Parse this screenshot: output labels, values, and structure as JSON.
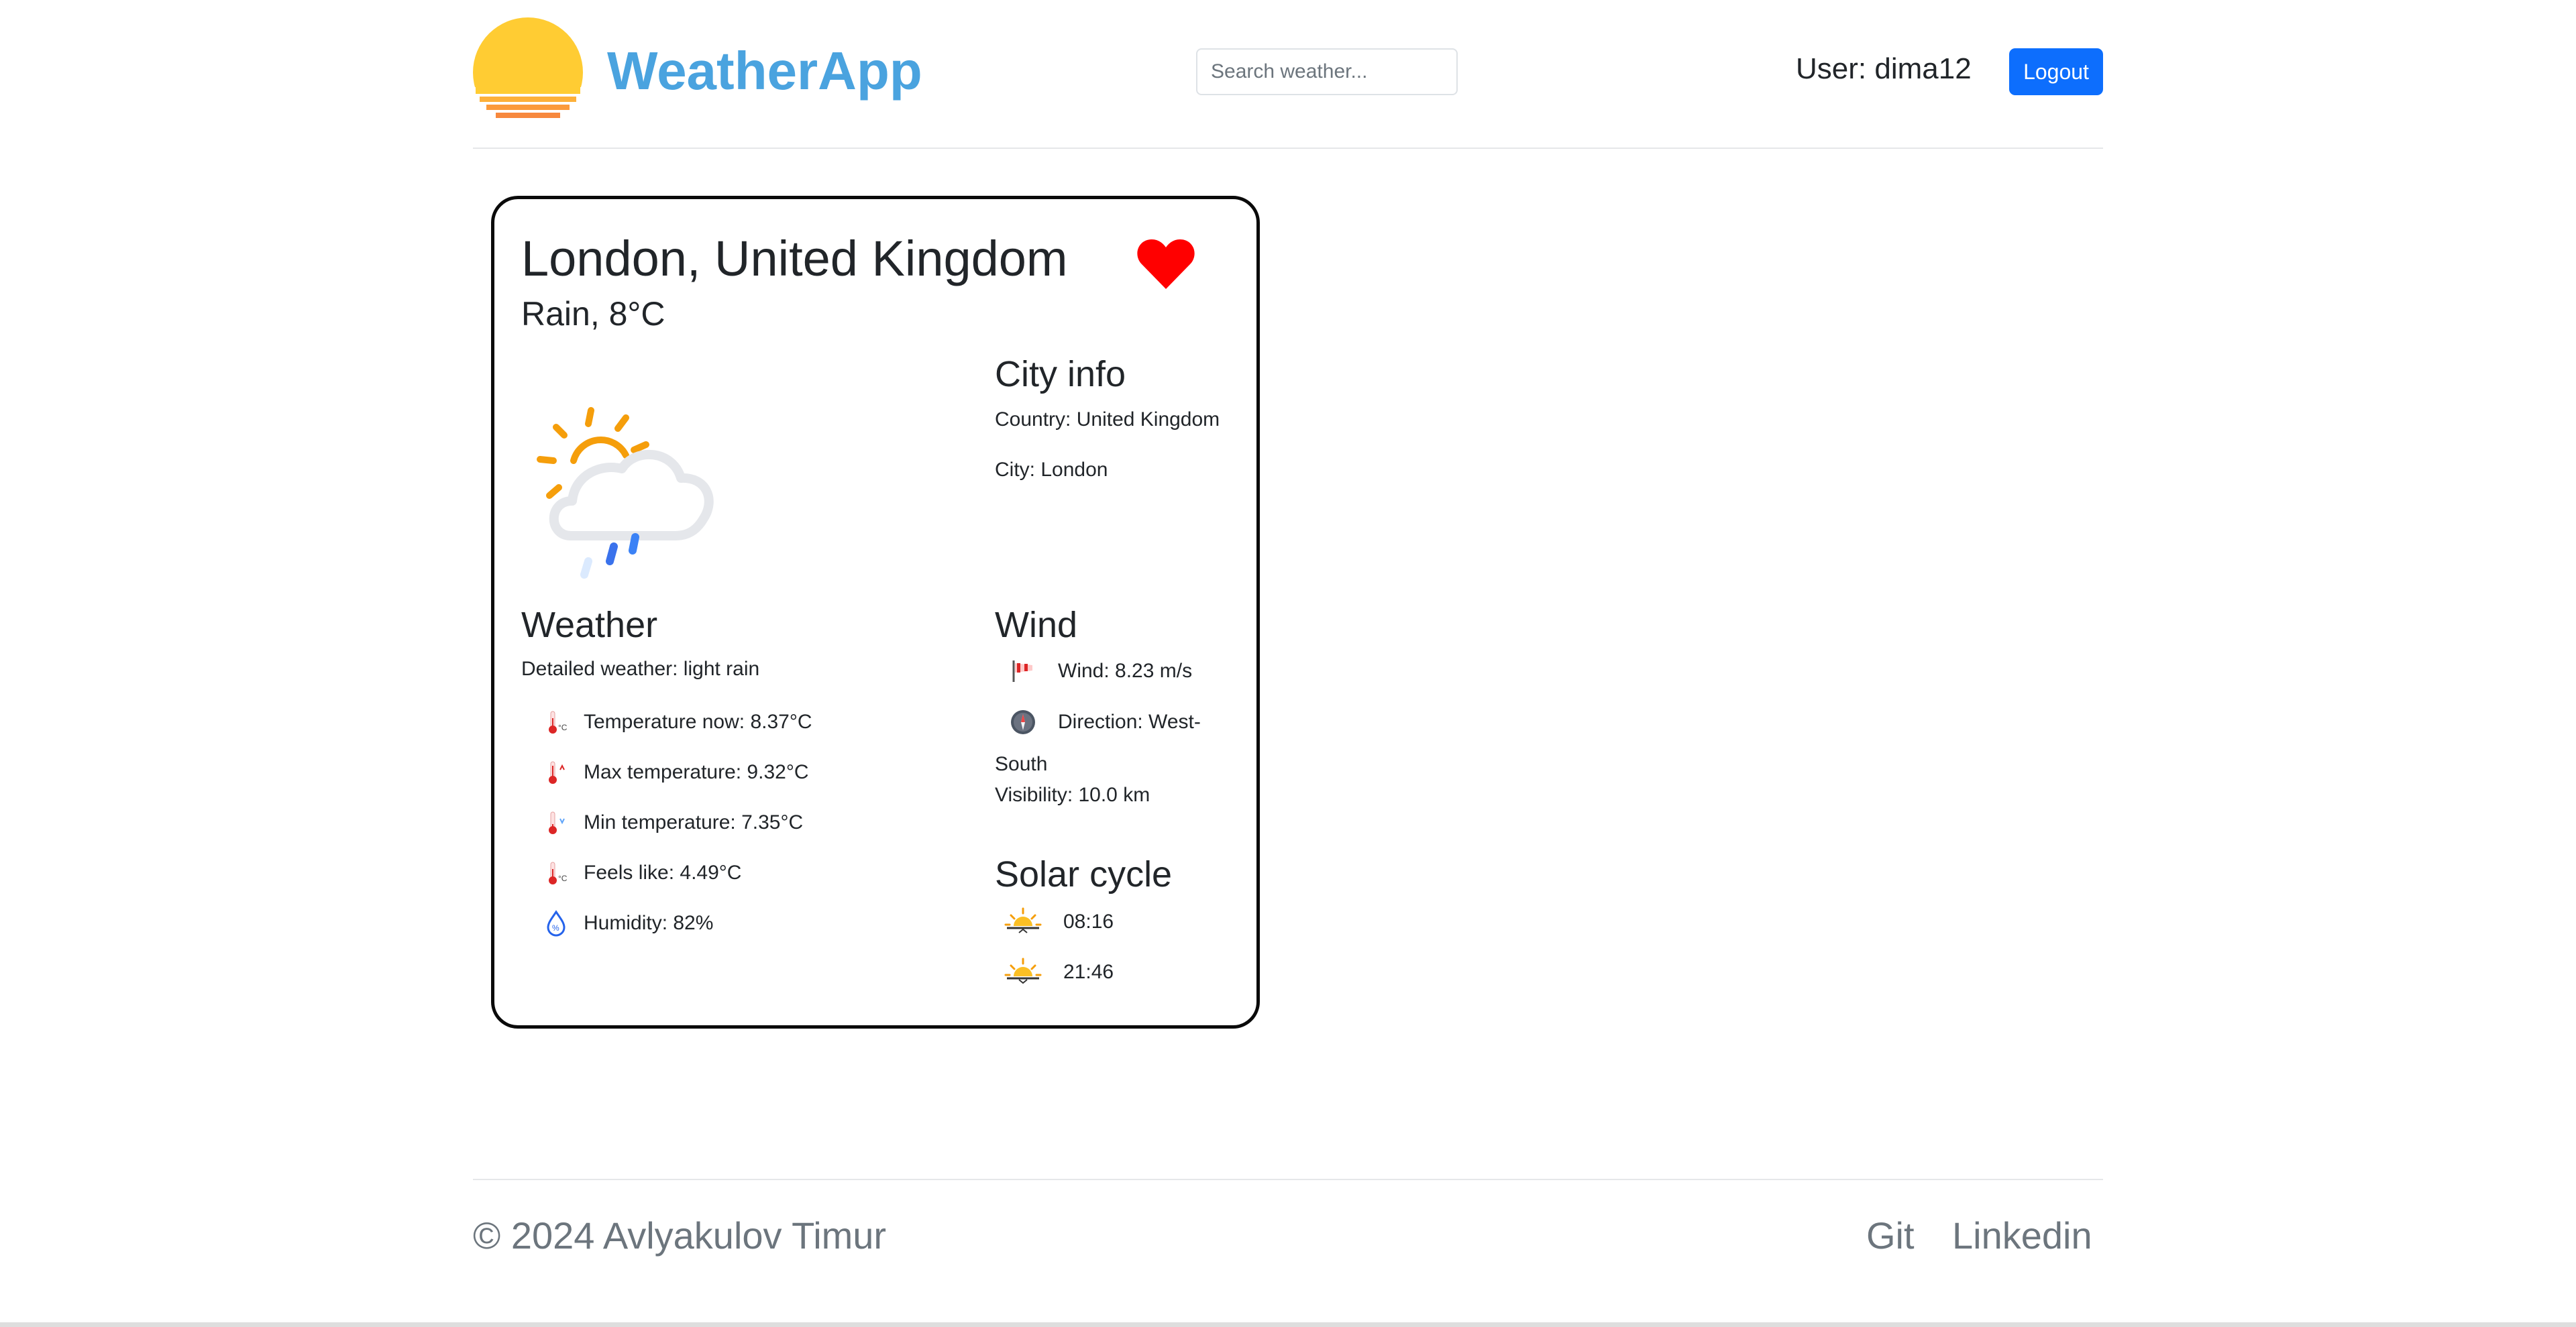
{
  "header": {
    "brand": "WeatherApp",
    "search_placeholder": "Search weather...",
    "user_label": "User: dima12",
    "logout_label": "Logout"
  },
  "card": {
    "title": "London, United Kingdom",
    "summary": "Rain, 8°C",
    "favorite": true,
    "city_info": {
      "heading": "City info",
      "country": "Country: United Kingdom",
      "city": "City: London"
    },
    "weather": {
      "heading": "Weather",
      "detailed": "Detailed weather: light rain",
      "rows": [
        {
          "icon": "thermometer-celsius-icon",
          "text": "Temperature now: 8.37°C"
        },
        {
          "icon": "thermometer-warmer-icon",
          "text": "Max temperature: 9.32°C"
        },
        {
          "icon": "thermometer-colder-icon",
          "text": "Min temperature: 7.35°C"
        },
        {
          "icon": "thermometer-celsius-icon",
          "text": "Feels like: 4.49°C"
        },
        {
          "icon": "humidity-icon",
          "text": "Humidity: 82%"
        }
      ]
    },
    "wind": {
      "heading": "Wind",
      "speed": "Wind: 8.23 m/s",
      "direction_line1": "Direction: West-",
      "direction_line2": "South",
      "visibility": "Visibility: 10.0 km"
    },
    "solar": {
      "heading": "Solar cycle",
      "sunrise": "08:16",
      "sunset": "21:46"
    }
  },
  "footer": {
    "copyright": "© 2024 Avlyakulov Timur",
    "links": [
      "Git",
      "Linkedin"
    ]
  },
  "colors": {
    "brand": "#4aa3df",
    "button": "#0d6efd",
    "heart": "#ff0000"
  }
}
